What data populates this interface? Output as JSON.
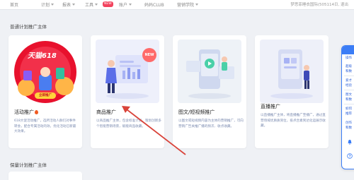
{
  "nav": {
    "items": [
      "首页",
      "计划",
      "报表",
      "工具",
      "账户",
      "妈妈CLUB",
      "营销学院"
    ],
    "new_badge": "NEW",
    "account": "梦思菲睡衣国际(505114日, 退出"
  },
  "sections": {
    "standard_title": "普通计划推广主体",
    "keep_title": "保量计划推广主体"
  },
  "cards": [
    {
      "title": "活动推广",
      "desc": "618大促活动推广，选所活动人群们对事件转会，配合专属活动的效，优化活动已新最大效果。",
      "banner_title": "天猫618",
      "banner_sub": "",
      "banner_cta": "立即推广",
      "has_flame": true
    },
    {
      "title": "商品推广",
      "desc": "以商品推广主体，包含标准计划，策划创新多个智能营销场景，赋能商品收藏。",
      "badge": "NEW"
    },
    {
      "title": "图文/短视频推广",
      "desc": "以图文或短视频内容为主体的营销推广，可向营销广告关推广播的频次、收点收藏。"
    },
    {
      "title": "直播推广",
      "desc": "以直播推广主体，将直播推广至播广，通过直营场域优质质资位，投点合素到达化运展示收藏。"
    }
  ],
  "right_panel": {
    "lines": [
      "操作",
      "超级",
      "和数",
      "爱才",
      "经验",
      "图文",
      "和数",
      "如何",
      "推荐",
      "创作",
      "和数"
    ]
  },
  "colors": {
    "accent": "#3b7df6",
    "badge": "#f2425d",
    "banner": "#e8112d",
    "desc": "#7b8bb0",
    "arrow": "#d9433a"
  },
  "icons": {
    "card2": "person-dashboard-illustration",
    "card3": "phone-video-illustration",
    "card4": "live-stream-illustration"
  }
}
